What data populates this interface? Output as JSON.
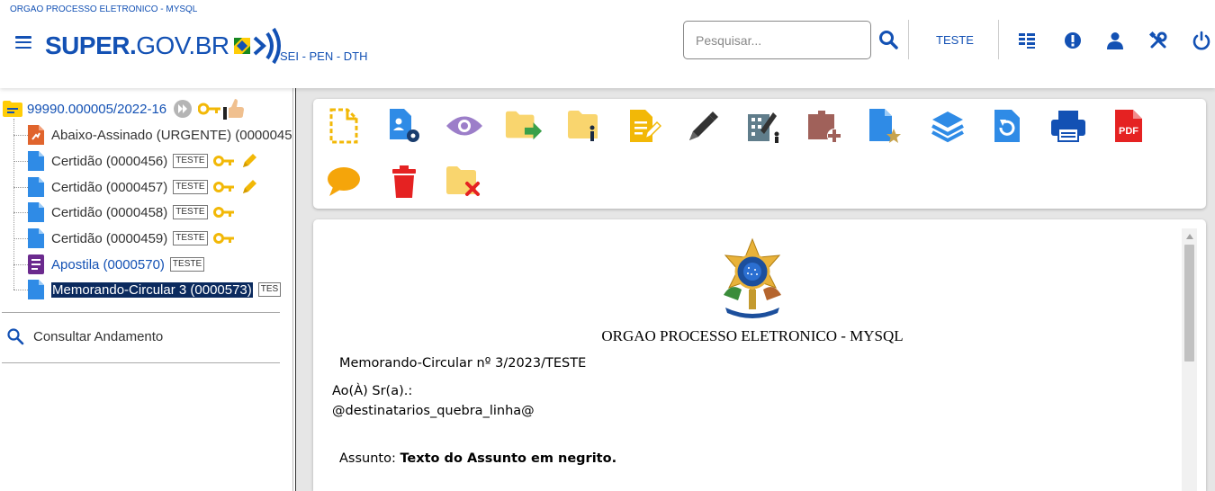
{
  "header": {
    "org_name": "ORGAO PROCESSO ELETRONICO - MYSQL",
    "logo_bold": "SUPER.",
    "logo_thin": "GOV.BR",
    "subtitle": "SEI - PEN - DTH",
    "search_placeholder": "Pesquisar...",
    "unit_label": "TESTE",
    "icons": [
      "menu-icon",
      "search-icon",
      "grid-icon",
      "alert-icon",
      "user-icon",
      "tools-icon",
      "power-icon"
    ]
  },
  "tree": {
    "process_number": "99990.000005/2022-16",
    "documents": [
      {
        "label": "Abaixo-Assinado (URGENTE) (0000045",
        "tag": "",
        "icon": "signature-doc-icon"
      },
      {
        "label": "Certidão (0000456)",
        "tag": "TESTE",
        "icon": "doc-icon"
      },
      {
        "label": "Certidão (0000457)",
        "tag": "TESTE",
        "icon": "doc-icon"
      },
      {
        "label": "Certidão (0000458)",
        "tag": "TESTE",
        "icon": "doc-icon"
      },
      {
        "label": "Certidão (0000459)",
        "tag": "TESTE",
        "icon": "doc-icon"
      },
      {
        "label": "Apostila (0000570)",
        "tag": "TESTE",
        "icon": "form-doc-icon"
      },
      {
        "label": "Memorando-Circular 3 (0000573)",
        "tag": "TES",
        "icon": "doc-icon"
      }
    ],
    "consult_label": "Consultar Andamento"
  },
  "toolbar": {
    "icons": [
      "new-document-icon",
      "process-settings-icon",
      "view-icon",
      "send-process-icon",
      "process-info-icon",
      "edit-document-icon",
      "sign-icon",
      "block-sign-icon",
      "add-block-icon",
      "favorite-document-icon",
      "layers-icon",
      "restore-icon",
      "print-icon",
      "pdf-icon",
      "comment-icon",
      "delete-icon",
      "close-process-icon"
    ],
    "pdf_label": "PDF"
  },
  "document": {
    "org": "ORGAO PROCESSO ELETRONICO - MYSQL",
    "title": "Memorando-Circular nº 3/2023/TESTE",
    "to_line": "Ao(À) Sr(a).:",
    "recipients": "@destinatarios_quebra_linha@",
    "subject_label": "Assunto:",
    "subject_text": "Texto do Assunto em negrito."
  }
}
